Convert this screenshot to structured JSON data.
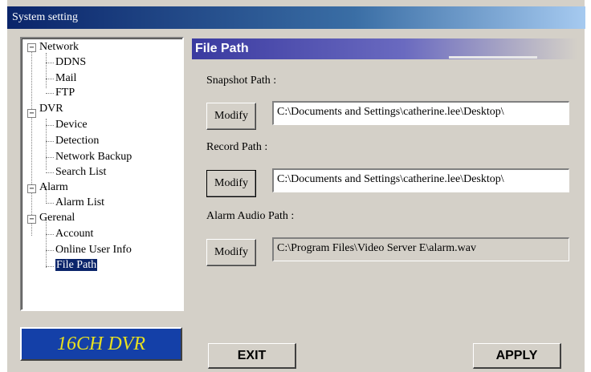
{
  "window": {
    "title": "System setting"
  },
  "tree": {
    "groups": [
      {
        "label": "Network",
        "toggle": "−",
        "children": [
          "DDNS",
          "Mail",
          "FTP"
        ]
      },
      {
        "label": "DVR",
        "toggle": "−",
        "children": [
          "Device",
          "Detection",
          "Network Backup",
          "Search List"
        ]
      },
      {
        "label": "Alarm",
        "toggle": "−",
        "children": [
          "Alarm List"
        ]
      },
      {
        "label": "Gerenal",
        "toggle": "−",
        "children": [
          "Account",
          "Online User Info",
          "File Path"
        ]
      }
    ],
    "selected": "File Path"
  },
  "logo": {
    "text": "16CH DVR"
  },
  "section": {
    "title": "File Path"
  },
  "paths": [
    {
      "label": "Snapshot Path :",
      "button": "Modify",
      "value": "C:\\Documents and Settings\\catherine.lee\\Desktop\\"
    },
    {
      "label": "Record Path :",
      "button": "Modify",
      "value": "C:\\Documents and Settings\\catherine.lee\\Desktop\\"
    },
    {
      "label": "Alarm Audio Path :",
      "button": "Modify",
      "value": "C:\\Program Files\\Video Server E\\alarm.wav"
    }
  ],
  "footer": {
    "exit_label": "EXIT",
    "apply_label": "APPLY"
  }
}
